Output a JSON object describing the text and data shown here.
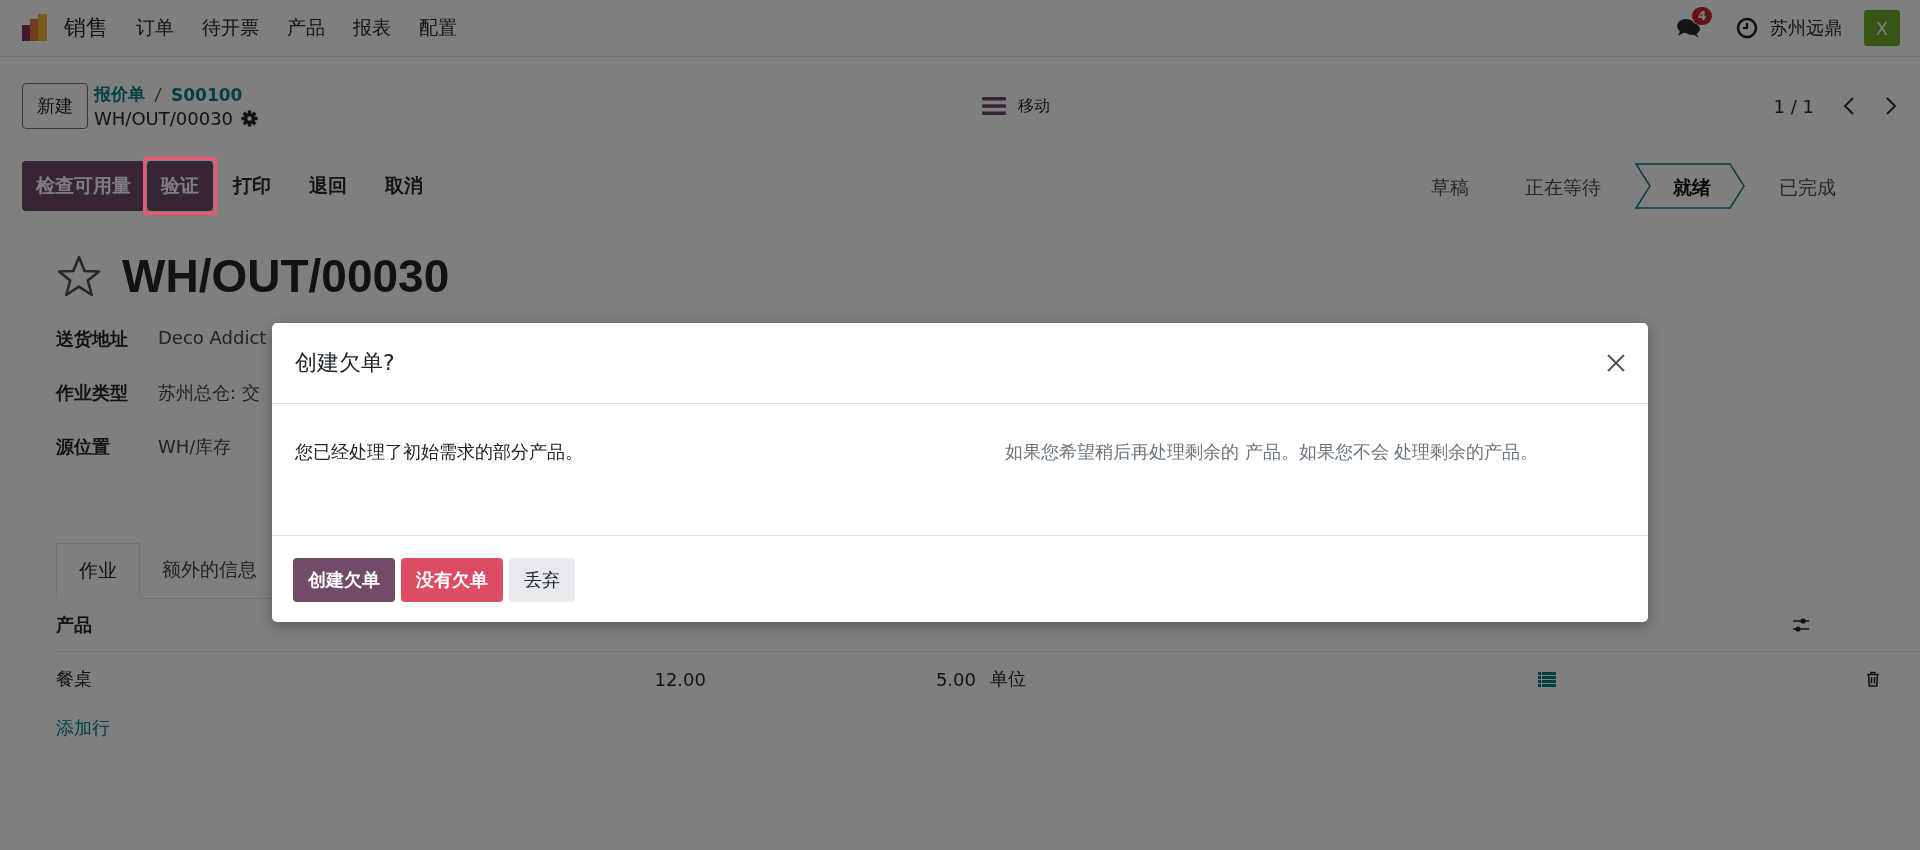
{
  "navbar": {
    "app_name": "销售",
    "menu": [
      "订单",
      "待开票",
      "产品",
      "报表",
      "配置"
    ],
    "messages_badge": "4",
    "company": "苏州远鼎",
    "avatar_letter": "X"
  },
  "control_panel": {
    "new_button": "新建",
    "breadcrumbs": [
      "报价单",
      "S00100"
    ],
    "record_name": "WH/OUT/00030",
    "actions_menu": "移动",
    "pager": "1 / 1"
  },
  "action_buttons": [
    {
      "label": "检查可用量",
      "kind": "primary",
      "highlighted": false
    },
    {
      "label": "验证",
      "kind": "primary",
      "highlighted": true
    },
    {
      "label": "打印",
      "kind": "plain",
      "highlighted": false
    },
    {
      "label": "退回",
      "kind": "plain",
      "highlighted": false
    },
    {
      "label": "取消",
      "kind": "plain",
      "highlighted": false
    }
  ],
  "statuses": [
    {
      "label": "草稿",
      "selected": false
    },
    {
      "label": "正在等待",
      "selected": false
    },
    {
      "label": "就绪",
      "selected": true
    },
    {
      "label": "已完成",
      "selected": false
    }
  ],
  "form": {
    "title": "WH/OUT/00030",
    "starred": false,
    "fields": [
      {
        "label": "送货地址",
        "value": "Deco Addict"
      },
      {
        "label": "作业类型",
        "value": "苏州总仓: 交"
      },
      {
        "label": "源位置",
        "value": "WH/库存"
      }
    ]
  },
  "tabs": [
    {
      "label": "作业",
      "selected": true
    },
    {
      "label": "额外的信息",
      "selected": false
    }
  ],
  "table": {
    "columns": [
      "产品"
    ],
    "rows": [
      {
        "product": "餐桌",
        "demand": "12.00",
        "quantity": "5.00",
        "unit": "单位"
      }
    ],
    "add_line": "添加行"
  },
  "dialog": {
    "title": "创建欠单?",
    "message": "您已经处理了初始需求的部分产品。",
    "hint": "如果您希望稍后再处理剩余的 产品。如果您不会 处理剩余的产品。",
    "buttons": [
      {
        "label": "创建欠单",
        "kind": "primary"
      },
      {
        "label": "没有欠单",
        "kind": "danger"
      },
      {
        "label": "丢弃",
        "kind": "secondary"
      }
    ]
  }
}
